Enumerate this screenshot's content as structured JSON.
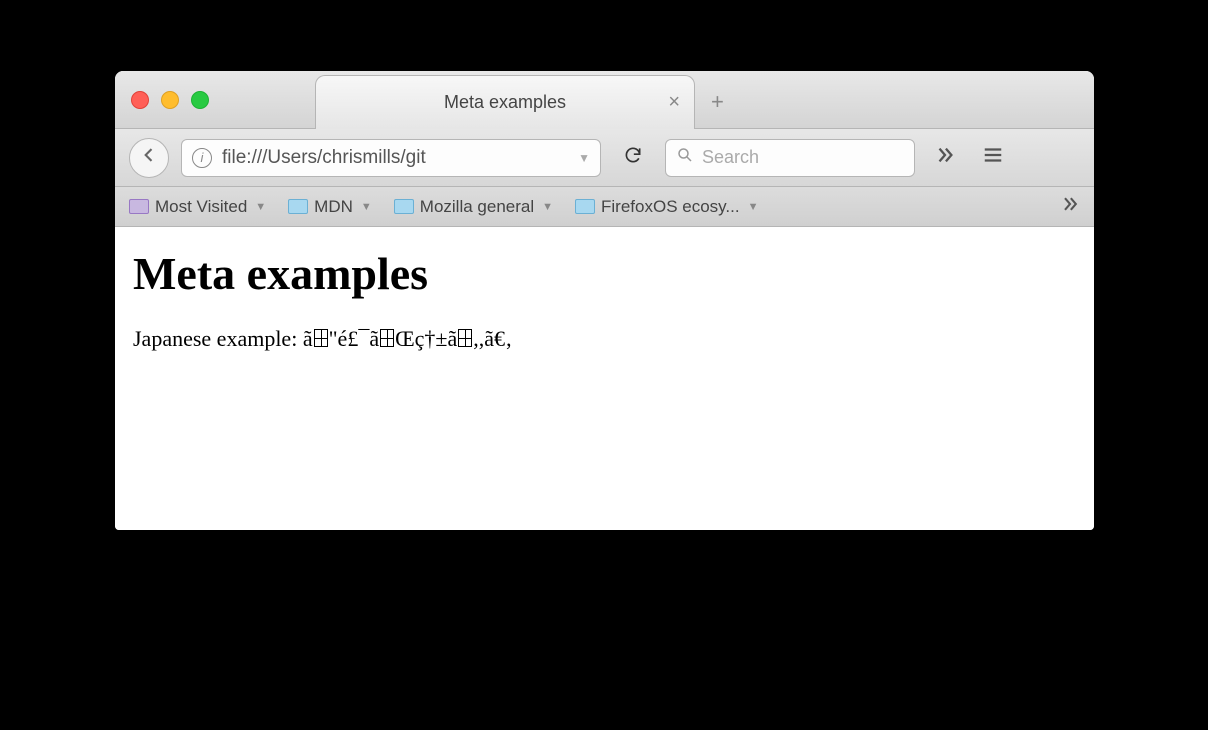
{
  "tab": {
    "title": "Meta examples"
  },
  "url": {
    "value": "file:///Users/chrismills/git"
  },
  "search": {
    "placeholder": "Search"
  },
  "bookmarks": {
    "items": [
      {
        "label": "Most Visited"
      },
      {
        "label": "MDN"
      },
      {
        "label": "Mozilla general"
      },
      {
        "label": "FirefoxOS ecosy..."
      }
    ]
  },
  "page": {
    "heading": "Meta examples",
    "paragraph_prefix": "Japanese example: ",
    "garbled_parts": [
      "ã",
      "\"é£¯ã",
      "Œç†±ã",
      ",,ã€‚"
    ]
  }
}
